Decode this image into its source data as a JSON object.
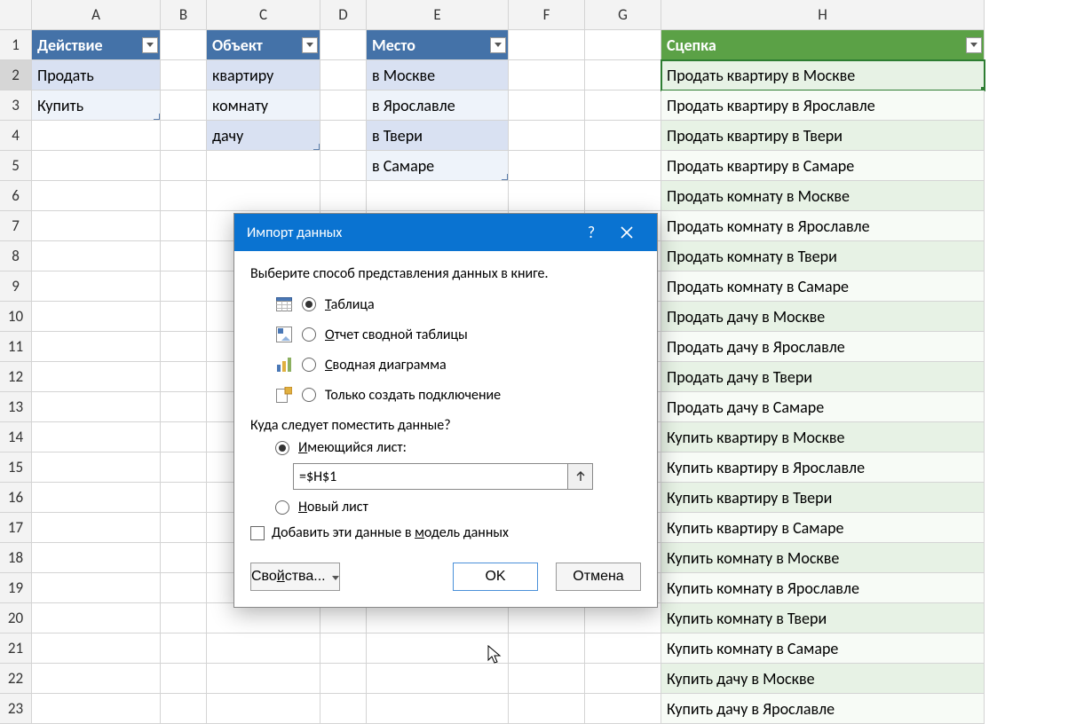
{
  "columns": [
    "A",
    "B",
    "C",
    "D",
    "E",
    "F",
    "G",
    "H"
  ],
  "rows": [
    "1",
    "2",
    "3",
    "4",
    "5",
    "6",
    "7",
    "8",
    "9",
    "10",
    "11",
    "12",
    "13",
    "14",
    "15",
    "16",
    "17",
    "18",
    "19",
    "20",
    "21",
    "22",
    "23"
  ],
  "tables": {
    "action": {
      "header": "Действие",
      "rows": [
        "Продать",
        "Купить"
      ]
    },
    "object": {
      "header": "Объект",
      "rows": [
        "квартиру",
        "комнату",
        "дачу"
      ]
    },
    "place": {
      "header": "Место",
      "rows": [
        "в Москве",
        "в Ярославле",
        "в Твери",
        "в Самаре"
      ]
    }
  },
  "result": {
    "header": "Сцепка",
    "rows": [
      "Продать квартиру в Москве",
      "Продать квартиру в Ярославле",
      "Продать квартиру в Твери",
      "Продать квартиру в Самаре",
      "Продать комнату в Москве",
      "Продать комнату в Ярославле",
      "Продать комнату в Твери",
      "Продать комнату в Самаре",
      "Продать дачу в Москве",
      "Продать дачу в Ярославле",
      "Продать дачу в Твери",
      "Продать дачу в Самаре",
      "Купить квартиру в Москве",
      "Купить квартиру в Ярославле",
      "Купить квартиру в Твери",
      "Купить квартиру в Самаре",
      "Купить комнату в Москве",
      "Купить комнату в Ярославле",
      "Купить комнату в Твери",
      "Купить комнату в Самаре",
      "Купить дачу в Москве",
      "Купить дачу в Ярославле"
    ]
  },
  "dialog": {
    "title": "Импорт данных",
    "help": "?",
    "prompt": "Выберите способ представления данных в книге.",
    "opt_table": "Таблица",
    "opt_pivot_report": "Отчет сводной таблицы",
    "opt_pivot_chart": "Сводная диаграмма",
    "opt_connection_only": "Только создать подключение",
    "placement_q": "Куда следует поместить данные?",
    "opt_existing": "Имеющийся лист:",
    "opt_new": "Новый лист",
    "ref_value": "=$H$1",
    "chk_model": "Добавить эти данные в модель данных",
    "btn_props": "Свойства...",
    "btn_ok": "OK",
    "btn_cancel": "Отмена"
  }
}
